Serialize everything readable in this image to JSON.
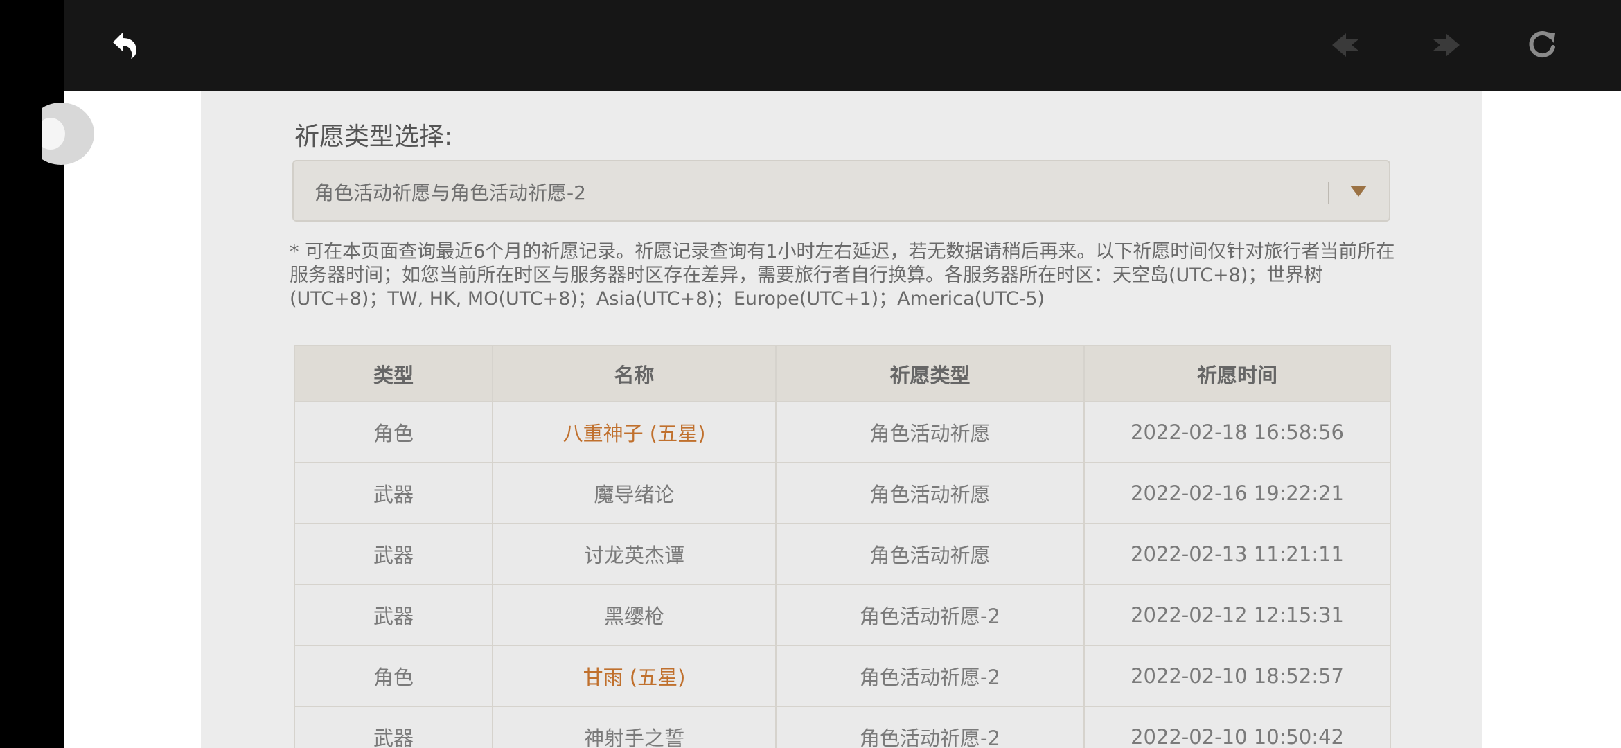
{
  "toolbar": {
    "back_icon": "back-arrow-icon",
    "prev_icon": "prev-arrow-icon",
    "next_icon": "next-arrow-icon",
    "reload_icon": "reload-icon"
  },
  "filter": {
    "label": "祈愿类型选择:",
    "selected": "角色活动祈愿与角色活动祈愿-2"
  },
  "notice": "* 可在本页面查询最近6个月的祈愿记录。祈愿记录查询有1小时左右延迟，若无数据请稍后再来。以下祈愿时间仅针对旅行者当前所在服务器时间；如您当前所在时区与服务器时区存在差异，需要旅行者自行换算。各服务器所在时区：天空岛(UTC+8)；世界树(UTC+8)；TW, HK, MO(UTC+8)；Asia(UTC+8)；Europe(UTC+1)；America(UTC-5)",
  "table": {
    "headers": [
      "类型",
      "名称",
      "祈愿类型",
      "祈愿时间"
    ],
    "rows": [
      {
        "type": "角色",
        "name": "八重神子 (五星)",
        "wish_type": "角色活动祈愿",
        "time": "2022-02-18 16:58:56"
      },
      {
        "type": "武器",
        "name": "魔导绪论",
        "wish_type": "角色活动祈愿",
        "time": "2022-02-16 19:22:21"
      },
      {
        "type": "武器",
        "name": "讨龙英杰谭",
        "wish_type": "角色活动祈愿",
        "time": "2022-02-13 11:21:11"
      },
      {
        "type": "武器",
        "name": "黑缨枪",
        "wish_type": "角色活动祈愿-2",
        "time": "2022-02-12 12:15:31"
      },
      {
        "type": "角色",
        "name": "甘雨 (五星)",
        "wish_type": "角色活动祈愿-2",
        "time": "2022-02-10 18:52:57"
      },
      {
        "type": "武器",
        "name": "神射手之誓",
        "wish_type": "角色活动祈愿-2",
        "time": "2022-02-10 10:50:42"
      }
    ]
  },
  "colors": {
    "toolbar_bg": "#161616",
    "panel_bg": "#ececec",
    "five_star": "#c0702d"
  }
}
